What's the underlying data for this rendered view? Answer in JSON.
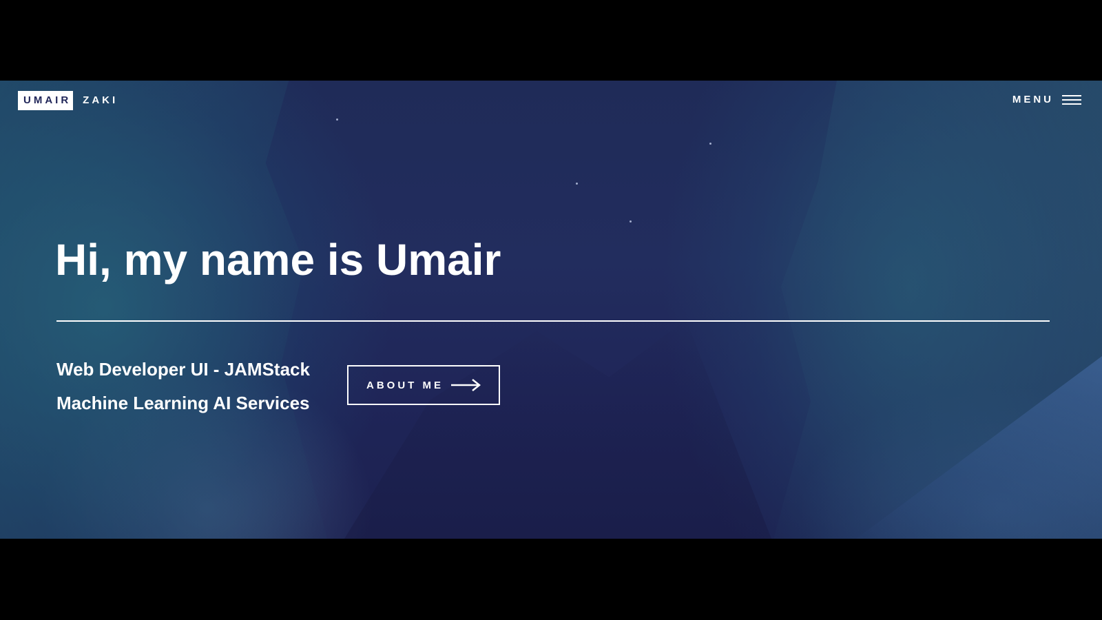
{
  "logo": {
    "primary": "UMAIR",
    "secondary": "ZAKI"
  },
  "nav": {
    "menu_label": "MENU",
    "menu_icon": "hamburger-icon"
  },
  "hero": {
    "headline": "Hi, my name is Umair",
    "taglines": [
      "Web Developer UI - JAMStack",
      "Machine Learning AI Services"
    ],
    "cta": {
      "label": "ABOUT ME",
      "icon": "arrow-right-icon"
    }
  },
  "colors": {
    "background": "#1f2558",
    "text": "#ffffff",
    "letterbox": "#000000"
  }
}
